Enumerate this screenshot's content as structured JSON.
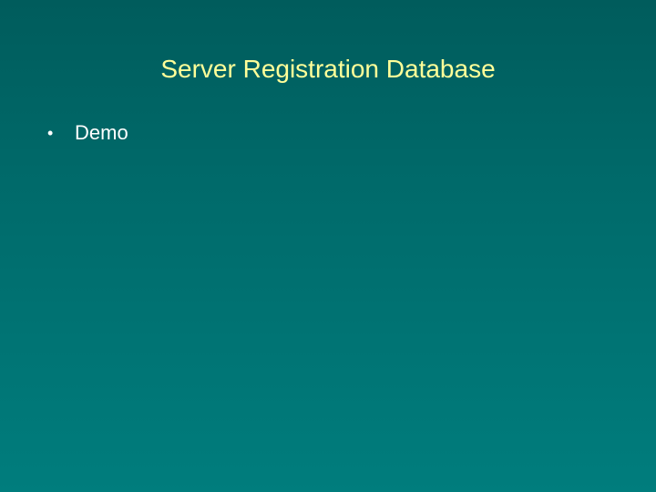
{
  "slide": {
    "title": "Server Registration Database",
    "bullets": [
      {
        "mark": "•",
        "text": "Demo"
      }
    ]
  },
  "colors": {
    "background_top": "#005c5c",
    "background_bottom": "#007d7d",
    "title": "#ffff99",
    "body_text": "#ffffff"
  }
}
